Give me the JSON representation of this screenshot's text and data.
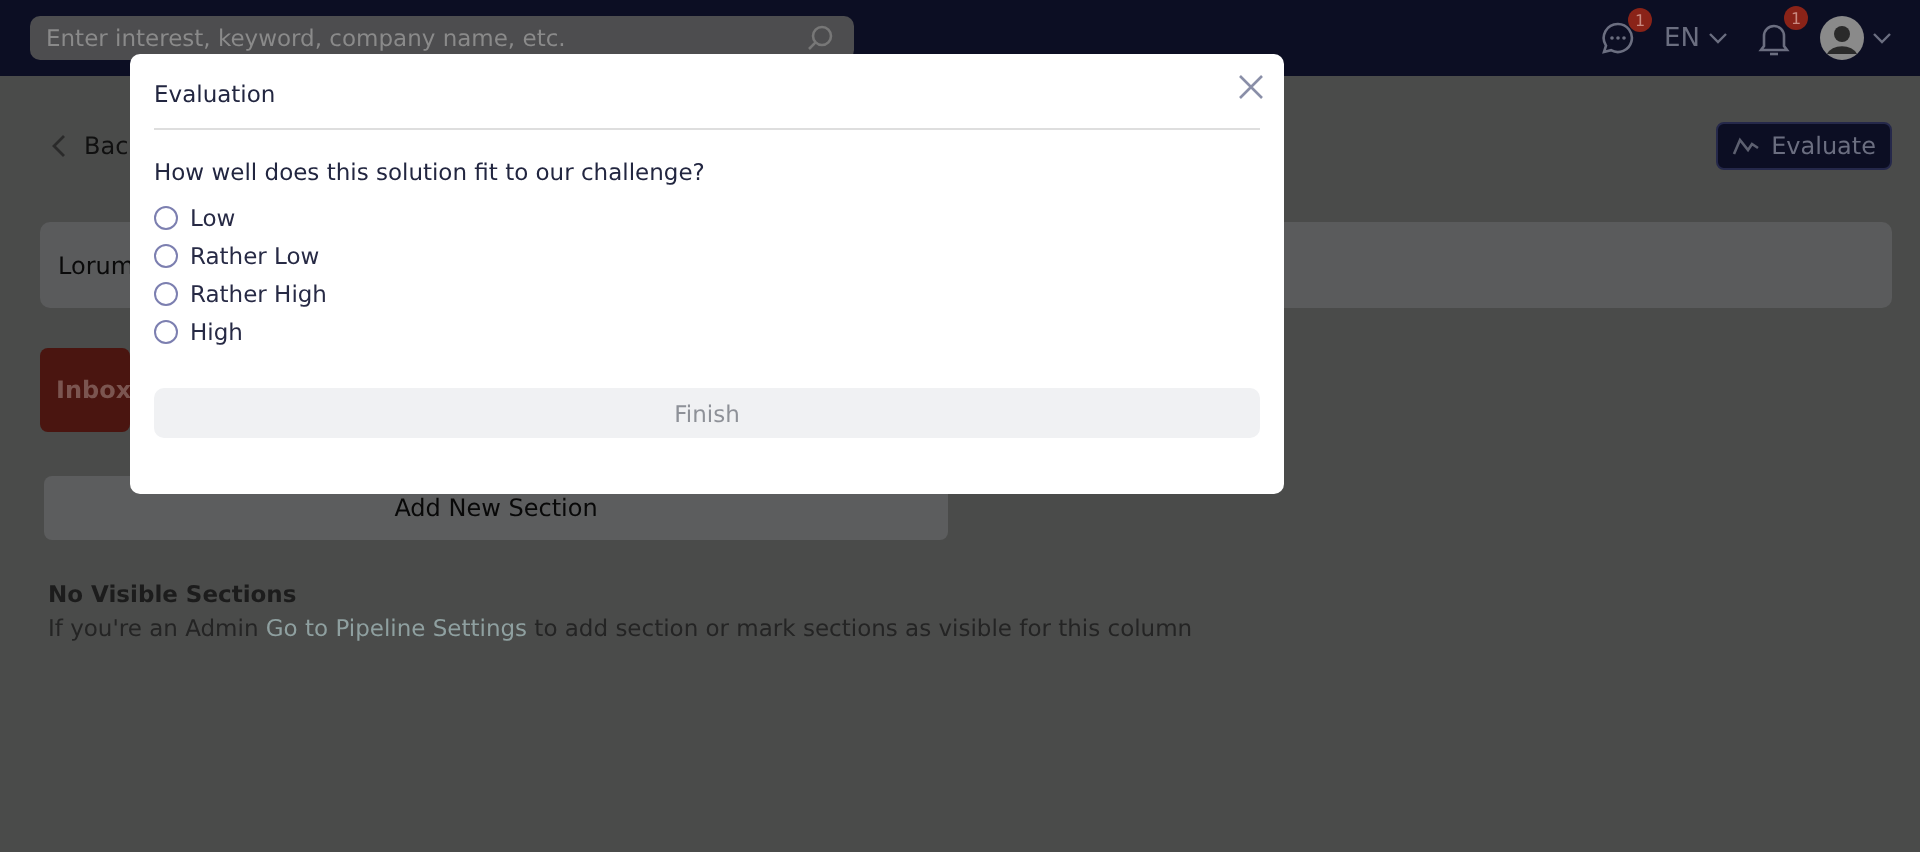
{
  "header": {
    "search": {
      "placeholder": "Enter interest, keyword, company name, etc."
    },
    "messages_badge": "1",
    "language": "EN",
    "notifications_badge": "1"
  },
  "page": {
    "back": "Bac",
    "evaluate_button": "Evaluate",
    "card_title": "Lorum",
    "column_title": "Inbox",
    "add_section": "Add New Section",
    "empty_title": "No Visible Sections",
    "empty_text_before": "If you're an Admin",
    "empty_link": "Go to Pipeline Settings",
    "empty_text_after": "to add section or mark sections as visible for this column"
  },
  "dialog": {
    "title": "Evaluation",
    "question": "How well does this solution fit to our challenge?",
    "options": [
      {
        "label": "Low",
        "selected": false
      },
      {
        "label": "Rather Low",
        "selected": false
      },
      {
        "label": "Rather High",
        "selected": false
      },
      {
        "label": "High",
        "selected": false
      }
    ],
    "finish_button": {
      "label": "Finish",
      "disabled": true
    }
  }
}
